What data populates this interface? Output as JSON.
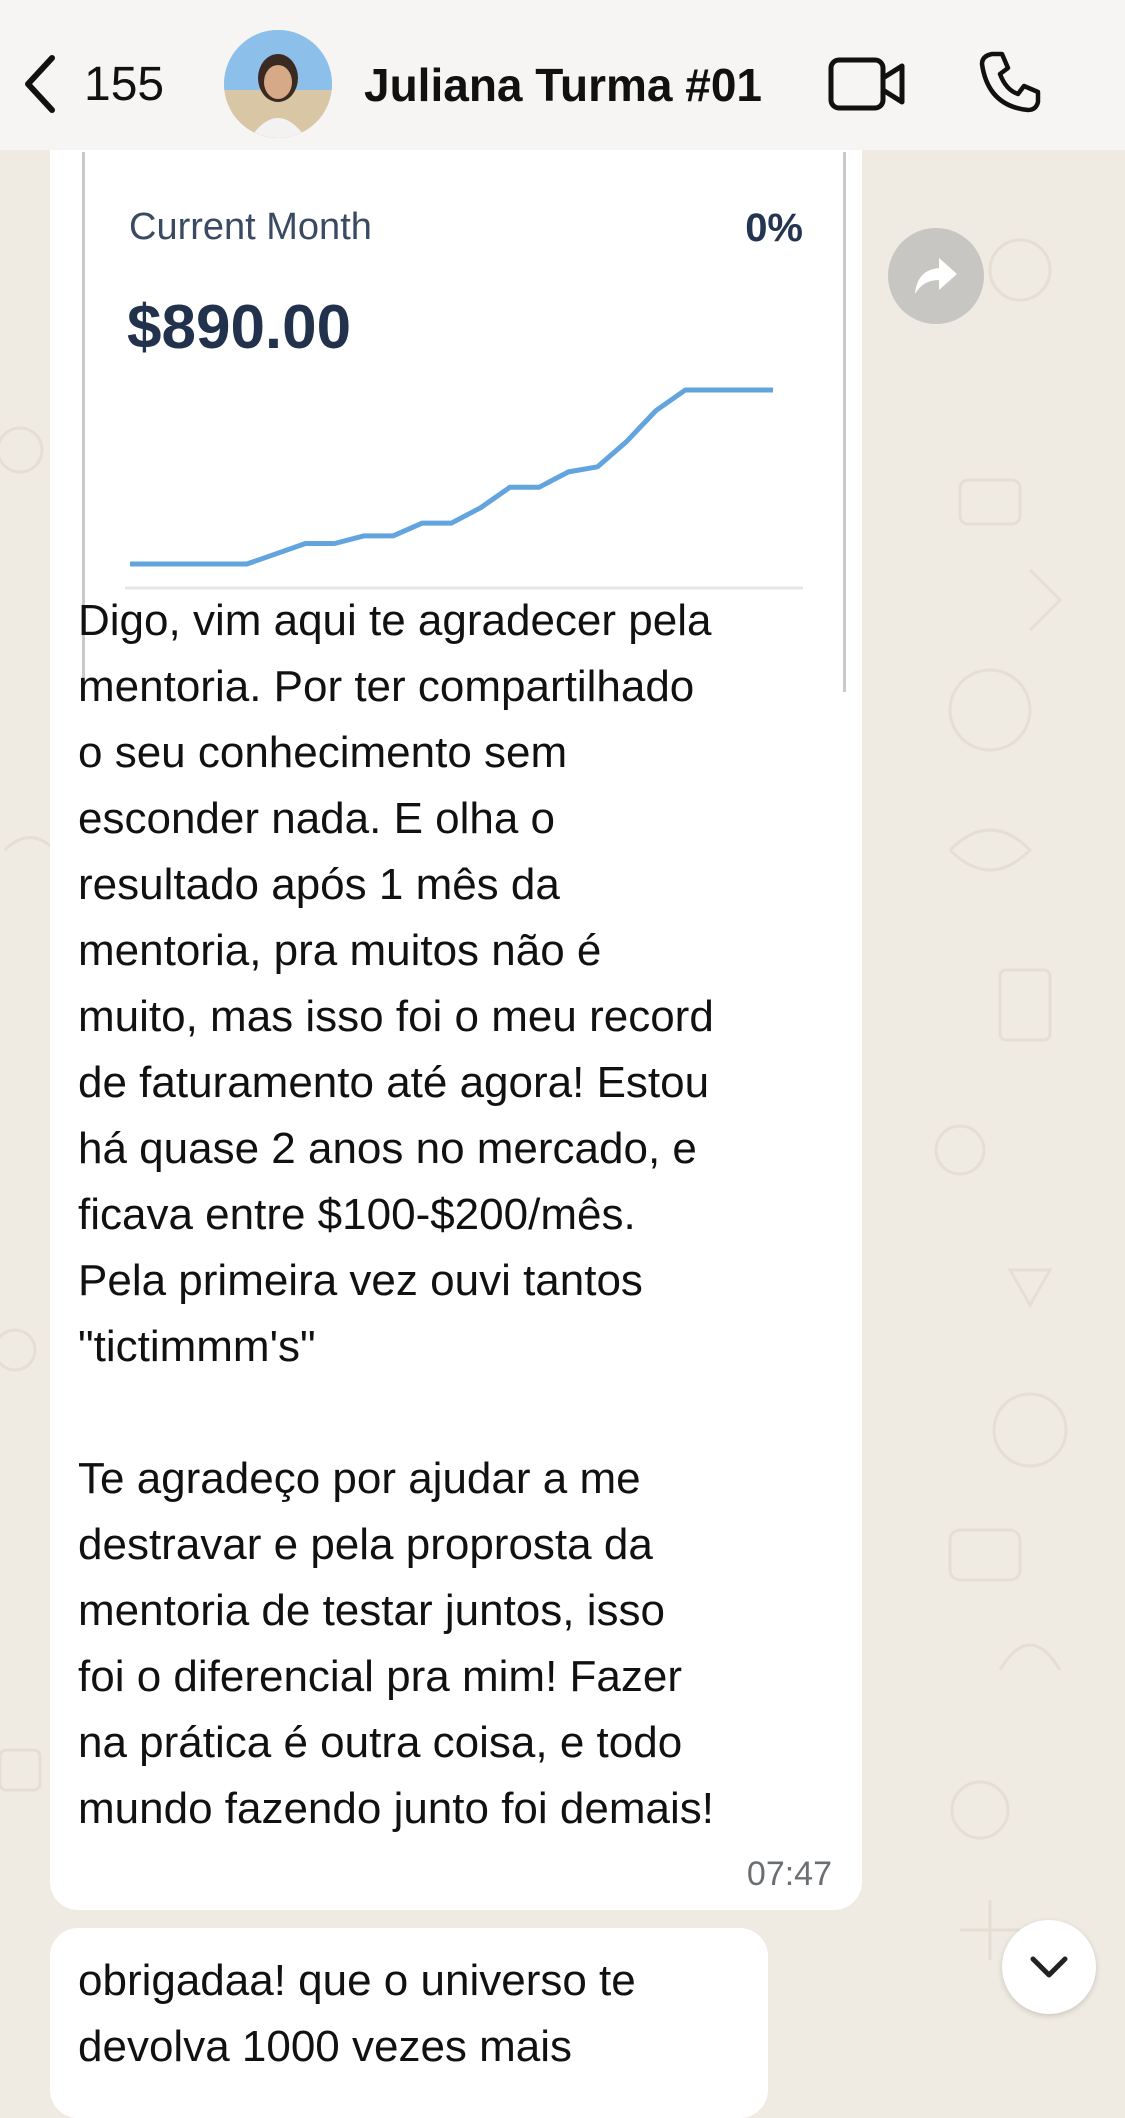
{
  "header": {
    "back_count": "155",
    "contact_name": "Juliana Turma #01",
    "icons": [
      "chevron-left-icon",
      "video-icon",
      "phone-icon"
    ]
  },
  "message1": {
    "chart_card": {
      "label": "Current Month",
      "percent": "0%",
      "amount": "$890.00"
    },
    "text": "Digo, vim aqui te agradecer pela\nmentoria. Por ter compartilhado\no seu conhecimento sem\nesconder nada. E olha o\nresultado após 1 mês da\nmentoria, pra muitos não é\nmuito, mas isso foi o meu record\nde faturamento até agora! Estou\nhá quase 2 anos no mercado, e\nficava entre $100-$200/mês.\nPela primeira vez ouvi tantos\n\"tictimmm's\"\n\nTe agradeço por ajudar a me\ndestravar e pela proprosta da\nmentoria de testar juntos, isso\nfoi o diferencial pra mim! Fazer\nna prática é outra coisa, e todo\nmundo fazendo junto foi demais!",
    "time": "07:47"
  },
  "message2": {
    "text": "obrigadaa! que o universo te\ndevolva 1000 vezes mais"
  },
  "colors": {
    "chat_background": "#efeae2",
    "bubble": "#ffffff",
    "chart_line": "#62a5de"
  },
  "chart_data": {
    "type": "line",
    "title": "Current Month",
    "series": [
      {
        "values": [
          0,
          0,
          0,
          0,
          0,
          4,
          8,
          8,
          11,
          11,
          16,
          16,
          22,
          30,
          30,
          36,
          38,
          48,
          60,
          68,
          68,
          68,
          68
        ]
      }
    ],
    "xlabel": "",
    "ylabel": "",
    "grid": false
  }
}
